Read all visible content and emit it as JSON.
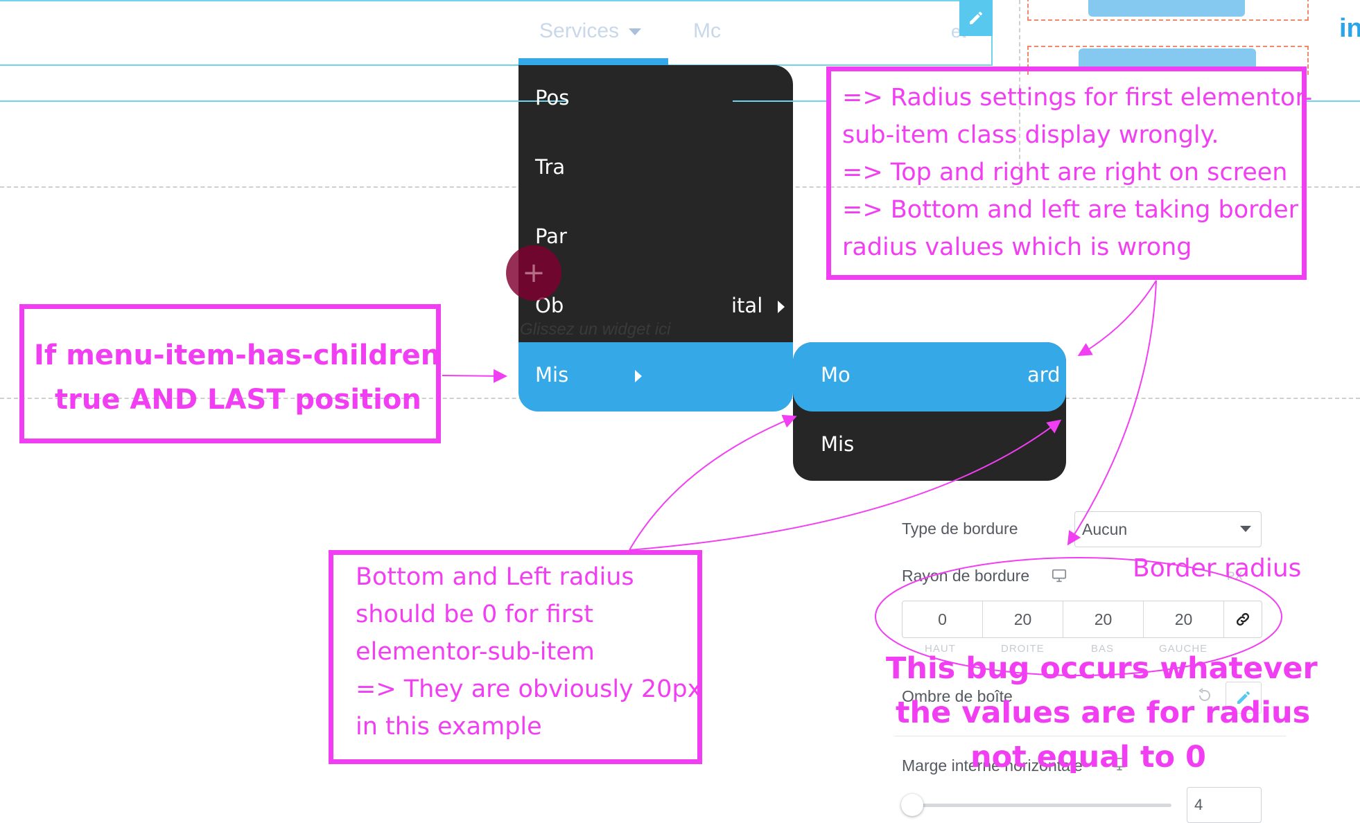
{
  "nav": {
    "services_label": "Services",
    "next_label_partial": "Mc",
    "far_label_partial": "et",
    "social_label": "in"
  },
  "submenu": {
    "items": [
      {
        "label": "Pos"
      },
      {
        "label": "Tra"
      },
      {
        "label": "Par"
      },
      {
        "label": "Ob",
        "suffix": "ital"
      },
      {
        "label": "Mis"
      }
    ]
  },
  "subsubmenu": {
    "items": [
      {
        "label": "Mo",
        "suffix": "ard"
      },
      {
        "label": "Mis"
      }
    ]
  },
  "canvas": {
    "drop_widget_text": "Glissez un widget ici",
    "add_button_symbol": "+"
  },
  "panel": {
    "border_type_label": "Type de bordure",
    "border_type_value": "Aucun",
    "border_radius_label": "Rayon de bordure",
    "unit_label": "PX",
    "radius_values": [
      "0",
      "20",
      "20",
      "20"
    ],
    "radius_sides": [
      "HAUT",
      "DROITE",
      "BAS",
      "GAUCHE"
    ],
    "box_shadow_label": "Ombre de boîte",
    "padding_label": "Marge interne horizontale",
    "padding_value": "4"
  },
  "annotations": {
    "left_box_lines": [
      "If menu-item-has-children",
      "true AND LAST position"
    ],
    "right_box_lines": [
      "=> Radius settings for first elementor-",
      "sub-item class display wrongly.",
      "=> Top and right are right on screen",
      "=> Bottom and left are taking border",
      "radius values which is wrong"
    ],
    "bottom_box_lines": [
      "Bottom and Left radius",
      "should be 0 for first",
      "elementor-sub-item",
      "=> They are obviously 20px",
      "in this example"
    ],
    "border_radius_caption": "Border radius",
    "bug_lines": [
      "This bug occurs whatever",
      "the values are for radius",
      "not equal to 0"
    ]
  },
  "colors": {
    "annotation": "#f23ef2",
    "menu_dark": "#262626",
    "menu_active": "#35a8e8",
    "guide_line": "#6fd3ee",
    "edit_button": "#58c8ef"
  },
  "icons": [
    "edit-pencil-icon",
    "caret-down-icon",
    "chevron-right-icon",
    "desktop-icon",
    "link-icon",
    "reset-icon",
    "plus-icon"
  ]
}
